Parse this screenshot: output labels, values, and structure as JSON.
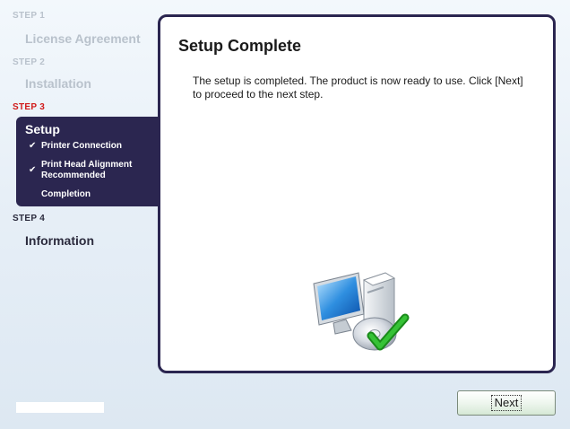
{
  "sidebar": {
    "steps": [
      {
        "step": "STEP 1",
        "title": "License Agreement"
      },
      {
        "step": "STEP 2",
        "title": "Installation"
      },
      {
        "step": "STEP 3",
        "title": "Setup"
      },
      {
        "step": "STEP 4",
        "title": "Information"
      }
    ],
    "substeps": [
      {
        "label": "Printer Connection",
        "checked": true
      },
      {
        "label": "Print Head Alignment",
        "label2": "Recommended",
        "checked": true
      },
      {
        "label": "Completion",
        "checked": false
      }
    ],
    "check_glyph": "✔"
  },
  "main": {
    "heading": "Setup Complete",
    "body": "The setup is completed. The product is now ready to use. Click [Next] to proceed to the next step."
  },
  "footer": {
    "next_label": "Next"
  },
  "colors": {
    "panel": "#2b2650",
    "active_step": "#d11a1a",
    "muted_step": "#b9c2cc"
  }
}
